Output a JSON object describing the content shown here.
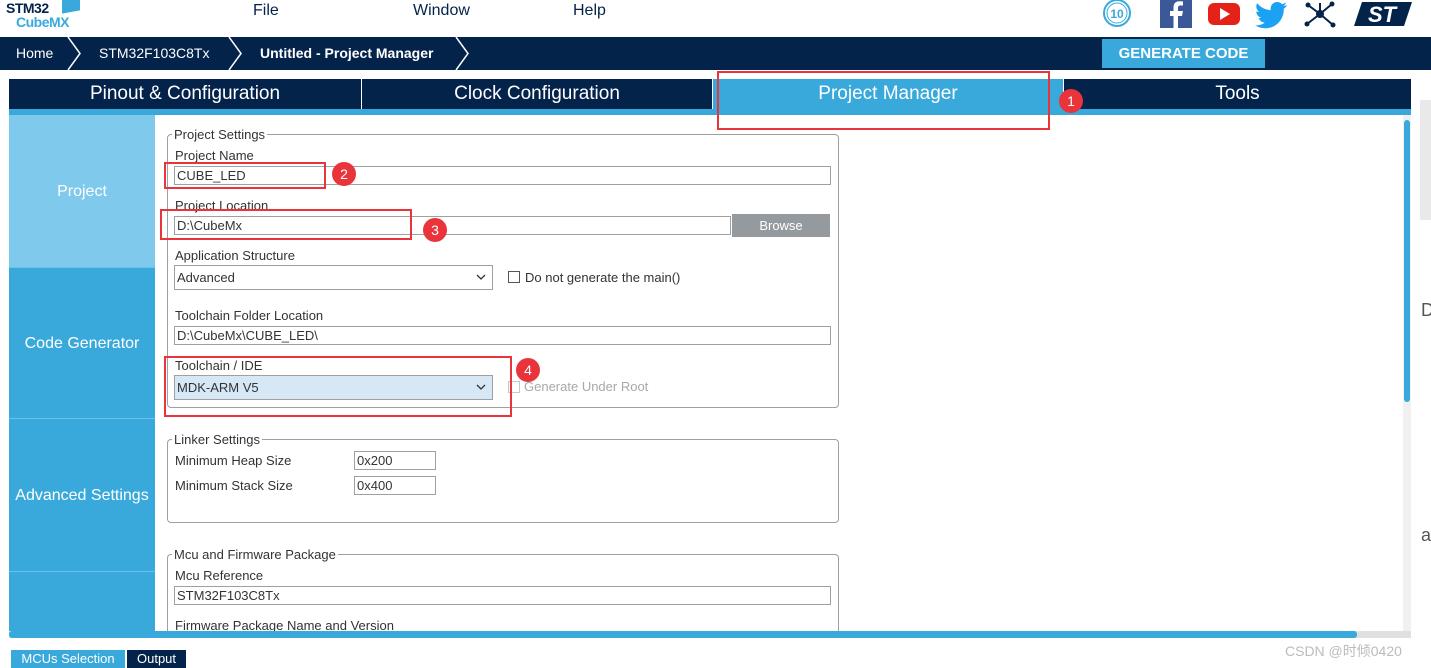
{
  "app": {
    "logo_line1": "STM32",
    "logo_line2": "CubeMX"
  },
  "menu": {
    "file": "File",
    "window": "Window",
    "help": "Help"
  },
  "social_icons": [
    "anniversary-10-icon",
    "facebook-icon",
    "youtube-icon",
    "twitter-icon",
    "network-icon",
    "st-logo-icon"
  ],
  "breadcrumb": [
    "Home",
    "STM32F103C8Tx",
    "Untitled - Project Manager"
  ],
  "generate_code": "GENERATE CODE",
  "tabs": [
    {
      "label": "Pinout & Configuration",
      "active": false
    },
    {
      "label": "Clock Configuration",
      "active": false
    },
    {
      "label": "Project Manager",
      "active": true
    },
    {
      "label": "Tools",
      "active": false
    }
  ],
  "sidenav": [
    "Project",
    "Code Generator",
    "Advanced Settings"
  ],
  "project_settings": {
    "legend": "Project Settings",
    "project_name_label": "Project Name",
    "project_name": "CUBE_LED",
    "project_location_label": "Project Location",
    "project_location": "D:\\CubeMx",
    "browse": "Browse",
    "app_structure_label": "Application Structure",
    "app_structure": "Advanced",
    "no_main_label": "Do not generate the main()",
    "toolchain_folder_label": "Toolchain Folder Location",
    "toolchain_folder": "D:\\CubeMx\\CUBE_LED\\",
    "toolchain_ide_label": "Toolchain / IDE",
    "toolchain_ide": "MDK-ARM V5",
    "generate_under_root_label": "Generate Under Root"
  },
  "linker_settings": {
    "legend": "Linker Settings",
    "heap_label": "Minimum Heap Size",
    "heap_value": "0x200",
    "stack_label": "Minimum Stack Size",
    "stack_value": "0x400"
  },
  "mcu_package": {
    "legend": "Mcu and Firmware Package",
    "mcu_ref_label": "Mcu Reference",
    "mcu_ref": "STM32F103C8Tx",
    "fw_label": "Firmware Package Name and Version"
  },
  "annotations": [
    "1",
    "2",
    "3",
    "4"
  ],
  "bottom_tabs": [
    "MCUs Selection",
    "Output"
  ],
  "watermark": "CSDN @时倾0420",
  "edge_text": [
    "D",
    "as"
  ],
  "colors": {
    "navy": "#03234b",
    "accent": "#39a9dc",
    "annotation_red": "#e8343a"
  }
}
